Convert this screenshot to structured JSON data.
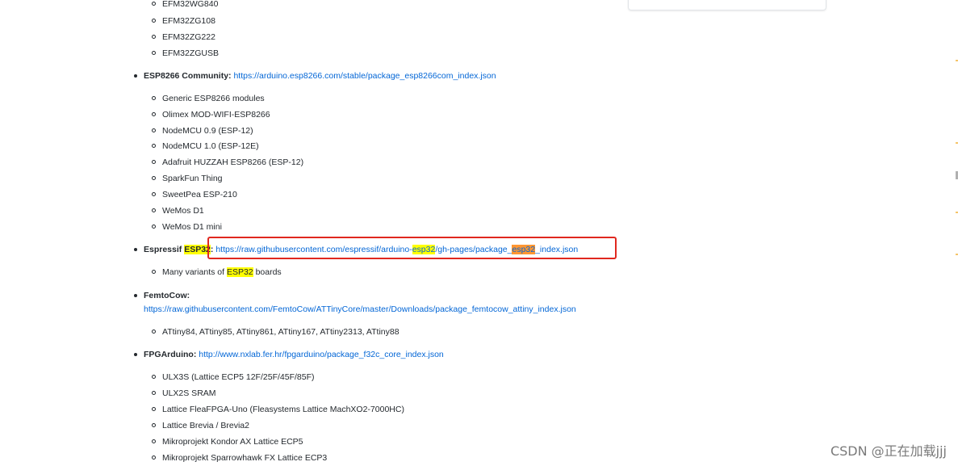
{
  "efm32_tail": [
    "EFM32WG840",
    "EFM32ZG108",
    "EFM32ZG222",
    "EFM32ZGUSB"
  ],
  "esp8266": {
    "vendor": "ESP8266 Community:",
    "url": "https://arduino.esp8266.com/stable/package_esp8266com_index.json",
    "boards": [
      "Generic ESP8266 modules",
      "Olimex MOD-WIFI-ESP8266",
      "NodeMCU 0.9 (ESP-12)",
      "NodeMCU 1.0 (ESP-12E)",
      "Adafruit HUZZAH ESP8266 (ESP-12)",
      "SparkFun Thing",
      "SweetPea ESP-210",
      "WeMos D1",
      "WeMos D1 mini"
    ]
  },
  "espressif": {
    "vendor_prefix": "Espressif ",
    "vendor_highlight": "ESP32",
    "vendor_suffix": ":",
    "url_part1": "https://raw.githubusercontent.com/espressif/arduino-",
    "url_hl1": "esp32",
    "url_part2": "/gh-pages/package_",
    "url_hl2": "esp32",
    "url_part3": "_index.json",
    "board_prefix": "Many variants of ",
    "board_highlight": "ESP32",
    "board_suffix": " boards"
  },
  "femtocow": {
    "vendor": "FemtoCow:",
    "url": "https://raw.githubusercontent.com/FemtoCow/ATTinyCore/master/Downloads/package_femtocow_attiny_index.json",
    "boards": [
      "ATtiny84, ATtiny85, ATtiny861, ATtiny167, ATtiny2313, ATtiny88"
    ]
  },
  "fpgarduino": {
    "vendor": "FPGArduino:",
    "url": "http://www.nxlab.fer.hr/fpgarduino/package_f32c_core_index.json",
    "boards": [
      "ULX3S (Lattice ECP5 12F/25F/45F/85F)",
      "ULX2S SRAM",
      "Lattice FleaFPGA-Uno (Fleasystems Lattice MachXO2-7000HC)",
      "Lattice Brevia / Brevia2",
      "Mikroprojekt Kondor AX Lattice ECP5",
      "Mikroprojekt Sparrowhawk FX Lattice ECP3"
    ]
  },
  "watermark": "CSDN @正在加载jjj",
  "colors": {
    "link": "#0366d6",
    "highlight_yellow": "#ffff00",
    "highlight_orange": "#ff9632",
    "annotation_red": "#e0281f"
  }
}
